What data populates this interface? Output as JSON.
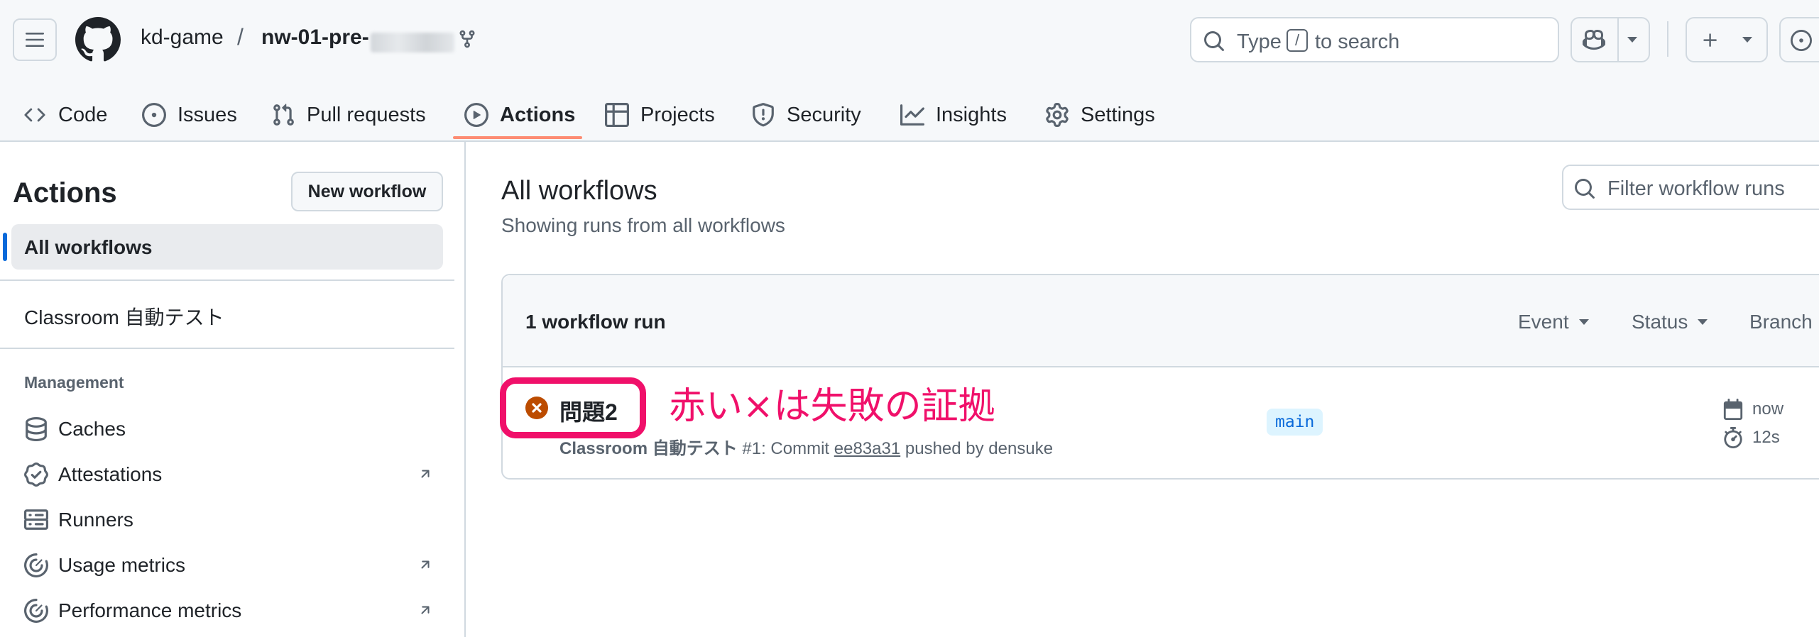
{
  "header": {
    "owner": "kd-game",
    "separator": "/",
    "repo": "nw-01-pre-",
    "search": {
      "prefix": "Type",
      "key": "/",
      "suffix": "to search"
    }
  },
  "tabs": [
    {
      "label": "Code",
      "icon": "code-icon"
    },
    {
      "label": "Issues",
      "icon": "issue-opened-icon"
    },
    {
      "label": "Pull requests",
      "icon": "git-pull-request-icon"
    },
    {
      "label": "Actions",
      "icon": "play-icon",
      "active": true
    },
    {
      "label": "Projects",
      "icon": "table-icon"
    },
    {
      "label": "Security",
      "icon": "shield-icon"
    },
    {
      "label": "Insights",
      "icon": "graph-icon"
    },
    {
      "label": "Settings",
      "icon": "gear-icon"
    }
  ],
  "sidebar": {
    "title": "Actions",
    "new_workflow": "New workflow",
    "all_workflows": "All workflows",
    "workflow_item": "Classroom 自動テスト",
    "management_heading": "Management",
    "management": [
      {
        "label": "Caches",
        "icon": "database-icon"
      },
      {
        "label": "Attestations",
        "icon": "verified-icon",
        "external": true
      },
      {
        "label": "Runners",
        "icon": "server-icon"
      },
      {
        "label": "Usage metrics",
        "icon": "meter-icon",
        "external": true
      },
      {
        "label": "Performance metrics",
        "icon": "meter-icon",
        "external": true
      }
    ]
  },
  "main": {
    "title": "All workflows",
    "subtitle": "Showing runs from all workflows",
    "filter_placeholder": "Filter workflow runs",
    "run_count": "1 workflow run",
    "filters": {
      "event": "Event",
      "status": "Status",
      "branch": "Branch"
    },
    "run": {
      "title": "問題2",
      "workflow": "Classroom 自動テスト",
      "meta_prefix": "#1: Commit",
      "sha": "ee83a31",
      "meta_suffix": "pushed by densuke",
      "branch": "main",
      "time": "now",
      "duration": "12s",
      "status": "failure"
    },
    "annotation": "赤い×は失敗の証拠"
  },
  "colors": {
    "accent": "#0969da",
    "tab_underline": "#fd8c73",
    "failure": "#bc4c00",
    "annotation": "#f0106a"
  }
}
